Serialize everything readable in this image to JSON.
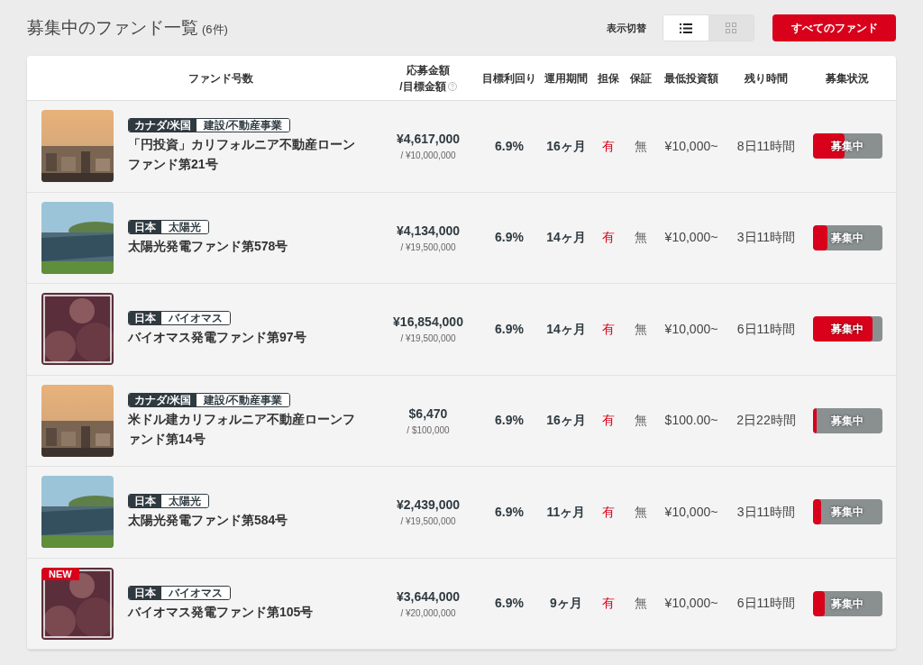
{
  "header": {
    "title": "募集中のファンド一覧",
    "count": "(6件)",
    "view_toggle_label": "表示切替",
    "views": [
      {
        "kind": "list",
        "selected": true
      },
      {
        "kind": "grid",
        "selected": false
      }
    ],
    "all_funds_button": "すべてのファンド"
  },
  "table": {
    "columns": [
      "ファンド号数",
      "応募金額",
      "/目標金額",
      "目標利回り",
      "運用期間",
      "担保",
      "保証",
      "最低投資額",
      "残り時間",
      "募集状況"
    ],
    "rows": [
      {
        "tags": [
          "カナダ/米国",
          "建設/不動産事業"
        ],
        "name": "「円投資」カリフォルニア不動産ローンファンド第21号",
        "amount": "¥4,617,000",
        "target": "/ ¥10,000,000",
        "yield": "6.9%",
        "period": "16ヶ月",
        "collateral": "有",
        "guarantee": "無",
        "minimum": "¥10,000~",
        "remaining": "8日11時間",
        "status": "募集中",
        "level": 0.46
      },
      {
        "tags": [
          "日本",
          "太陽光"
        ],
        "name": "太陽光発電ファンド第578号",
        "amount": "¥4,134,000",
        "target": "/ ¥19,500,000",
        "yield": "6.9%",
        "period": "14ヶ月",
        "collateral": "有",
        "guarantee": "無",
        "minimum": "¥10,000~",
        "remaining": "3日11時間",
        "status": "募集中",
        "level": 0.21
      },
      {
        "tags": [
          "日本",
          "バイオマス"
        ],
        "name": "バイオマス発電ファンド第97号",
        "amount": "¥16,854,000",
        "target": "/ ¥19,500,000",
        "yield": "6.9%",
        "period": "14ヶ月",
        "collateral": "有",
        "guarantee": "無",
        "minimum": "¥10,000~",
        "remaining": "6日11時間",
        "status": "募集中",
        "level": 0.86
      },
      {
        "tags": [
          "カナダ/米国",
          "建設/不動産事業"
        ],
        "name": "米ドル建カリフォルニア不動産ローンファンド第14号",
        "amount": "$6,470",
        "target": "/ $100,000",
        "yield": "6.9%",
        "period": "16ヶ月",
        "collateral": "有",
        "guarantee": "無",
        "minimum": "$100.00~",
        "remaining": "2日22時間",
        "status": "募集中",
        "level": 0.06
      },
      {
        "tags": [
          "日本",
          "太陽光"
        ],
        "name": "太陽光発電ファンド第584号",
        "amount": "¥2,439,000",
        "target": "/ ¥19,500,000",
        "yield": "6.9%",
        "period": "11ヶ月",
        "collateral": "有",
        "guarantee": "無",
        "minimum": "¥10,000~",
        "remaining": "3日11時間",
        "status": "募集中",
        "level": 0.125
      },
      {
        "badge": "NEW",
        "tags": [
          "日本",
          "バイオマス"
        ],
        "name": "バイオマス発電ファンド第105号",
        "amount": "¥3,644,000",
        "target": "/ ¥20,000,000",
        "yield": "6.9%",
        "period": "9ヶ月",
        "collateral": "有",
        "guarantee": "無",
        "minimum": "¥10,000~",
        "remaining": "6日11時間",
        "status": "募集中",
        "level": 0.18
      }
    ]
  }
}
